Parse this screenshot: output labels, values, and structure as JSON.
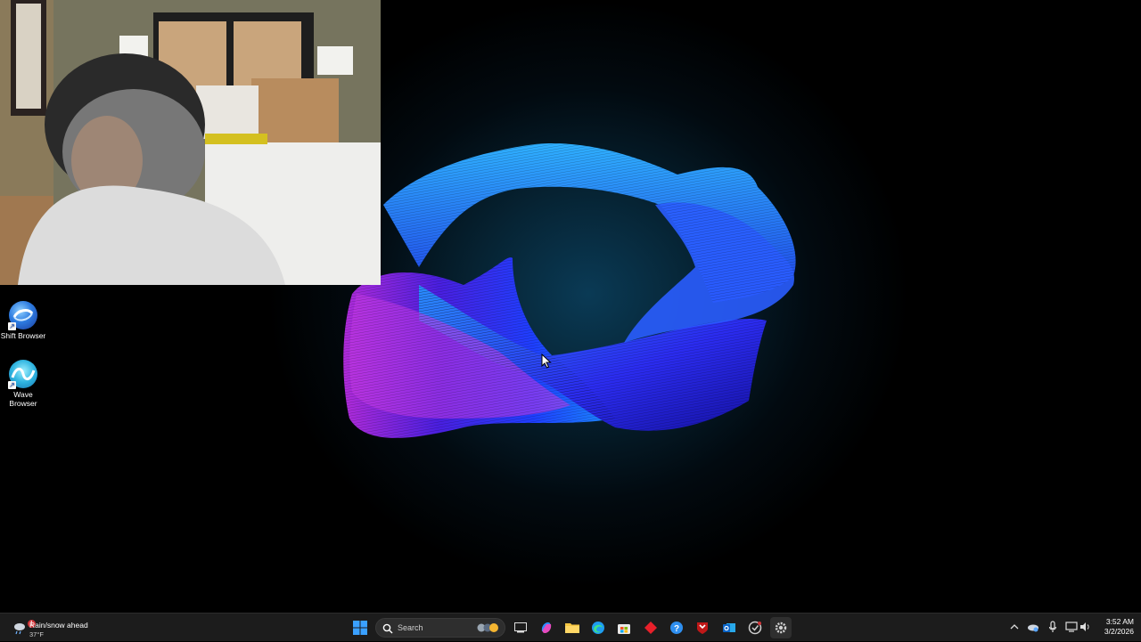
{
  "desktop": {
    "icons": [
      {
        "label": "Shift Browser",
        "icon": "shift-browser-icon"
      },
      {
        "label": "Wave Browser",
        "icon": "wave-browser-icon"
      }
    ]
  },
  "taskbar": {
    "weather": {
      "title": "Rain/snow ahead",
      "temp": "37°F",
      "badge": "1",
      "icon": "weather-rain-snow-icon"
    },
    "search": {
      "placeholder": "Search"
    },
    "pinned_apps": [
      "start-icon",
      "task-view-icon",
      "copilot-icon",
      "file-explorer-icon",
      "edge-icon",
      "microsoft-store-icon",
      "red-diamond-app-icon",
      "help-icon",
      "mcafee-icon",
      "outlook-icon",
      "app-icon",
      "settings-icon"
    ],
    "clock": {
      "time": "3:52 AM",
      "date": "3/2/2026"
    }
  },
  "colors": {
    "taskbar": "#1c1c1c",
    "accent": "#0078d4",
    "badge": "#d13438"
  }
}
